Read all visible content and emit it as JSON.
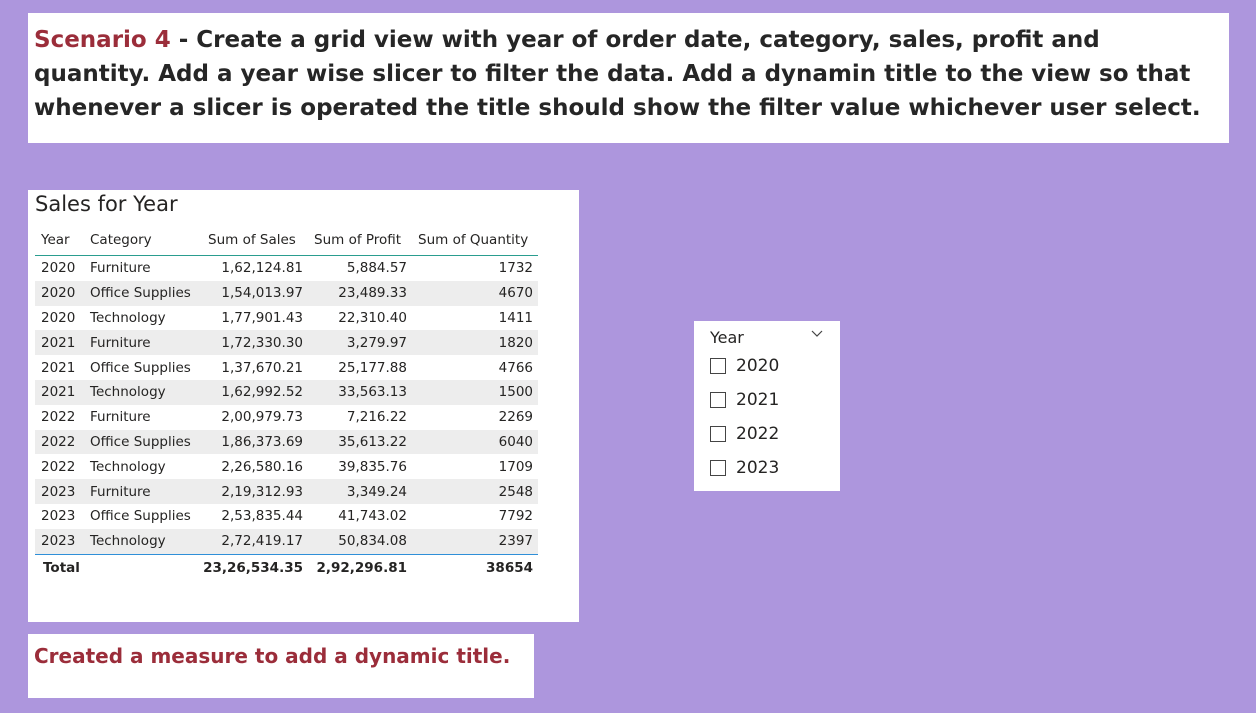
{
  "scenario": {
    "tag": "Scenario 4",
    "text": " - Create a grid view with year of order date, category, sales, profit and quantity. Add a year wise slicer to filter the data. Add a dynamin title to the view so that whenever a slicer is operated the title should show the filter value whichever user select."
  },
  "table": {
    "title": "Sales for Year",
    "headers": {
      "year": "Year",
      "category": "Category",
      "sales": "Sum of Sales",
      "profit": "Sum of Profit",
      "quantity": "Sum of Quantity"
    },
    "rows": [
      {
        "year": "2020",
        "category": "Furniture",
        "sales": "1,62,124.81",
        "profit": "5,884.57",
        "quantity": "1732"
      },
      {
        "year": "2020",
        "category": "Office Supplies",
        "sales": "1,54,013.97",
        "profit": "23,489.33",
        "quantity": "4670"
      },
      {
        "year": "2020",
        "category": "Technology",
        "sales": "1,77,901.43",
        "profit": "22,310.40",
        "quantity": "1411"
      },
      {
        "year": "2021",
        "category": "Furniture",
        "sales": "1,72,330.30",
        "profit": "3,279.97",
        "quantity": "1820"
      },
      {
        "year": "2021",
        "category": "Office Supplies",
        "sales": "1,37,670.21",
        "profit": "25,177.88",
        "quantity": "4766"
      },
      {
        "year": "2021",
        "category": "Technology",
        "sales": "1,62,992.52",
        "profit": "33,563.13",
        "quantity": "1500"
      },
      {
        "year": "2022",
        "category": "Furniture",
        "sales": "2,00,979.73",
        "profit": "7,216.22",
        "quantity": "2269"
      },
      {
        "year": "2022",
        "category": "Office Supplies",
        "sales": "1,86,373.69",
        "profit": "35,613.22",
        "quantity": "6040"
      },
      {
        "year": "2022",
        "category": "Technology",
        "sales": "2,26,580.16",
        "profit": "39,835.76",
        "quantity": "1709"
      },
      {
        "year": "2023",
        "category": "Furniture",
        "sales": "2,19,312.93",
        "profit": "3,349.24",
        "quantity": "2548"
      },
      {
        "year": "2023",
        "category": "Office Supplies",
        "sales": "2,53,835.44",
        "profit": "41,743.02",
        "quantity": "7792"
      },
      {
        "year": "2023",
        "category": "Technology",
        "sales": "2,72,419.17",
        "profit": "50,834.08",
        "quantity": "2397"
      }
    ],
    "total": {
      "label": "Total",
      "sales": "23,26,534.35",
      "profit": "2,92,296.81",
      "quantity": "38654"
    }
  },
  "slicer": {
    "title": "Year",
    "options": [
      {
        "label": "2020",
        "checked": false
      },
      {
        "label": "2021",
        "checked": false
      },
      {
        "label": "2022",
        "checked": false
      },
      {
        "label": "2023",
        "checked": false
      }
    ]
  },
  "note": {
    "text": "Created a measure to add a dynamic title."
  },
  "colors": {
    "background": "#ad96dd",
    "accent": "#9b2d3a",
    "header_rule": "#2a9d8f",
    "total_rule": "#2f8fd8",
    "alt_row": "#ededed"
  }
}
